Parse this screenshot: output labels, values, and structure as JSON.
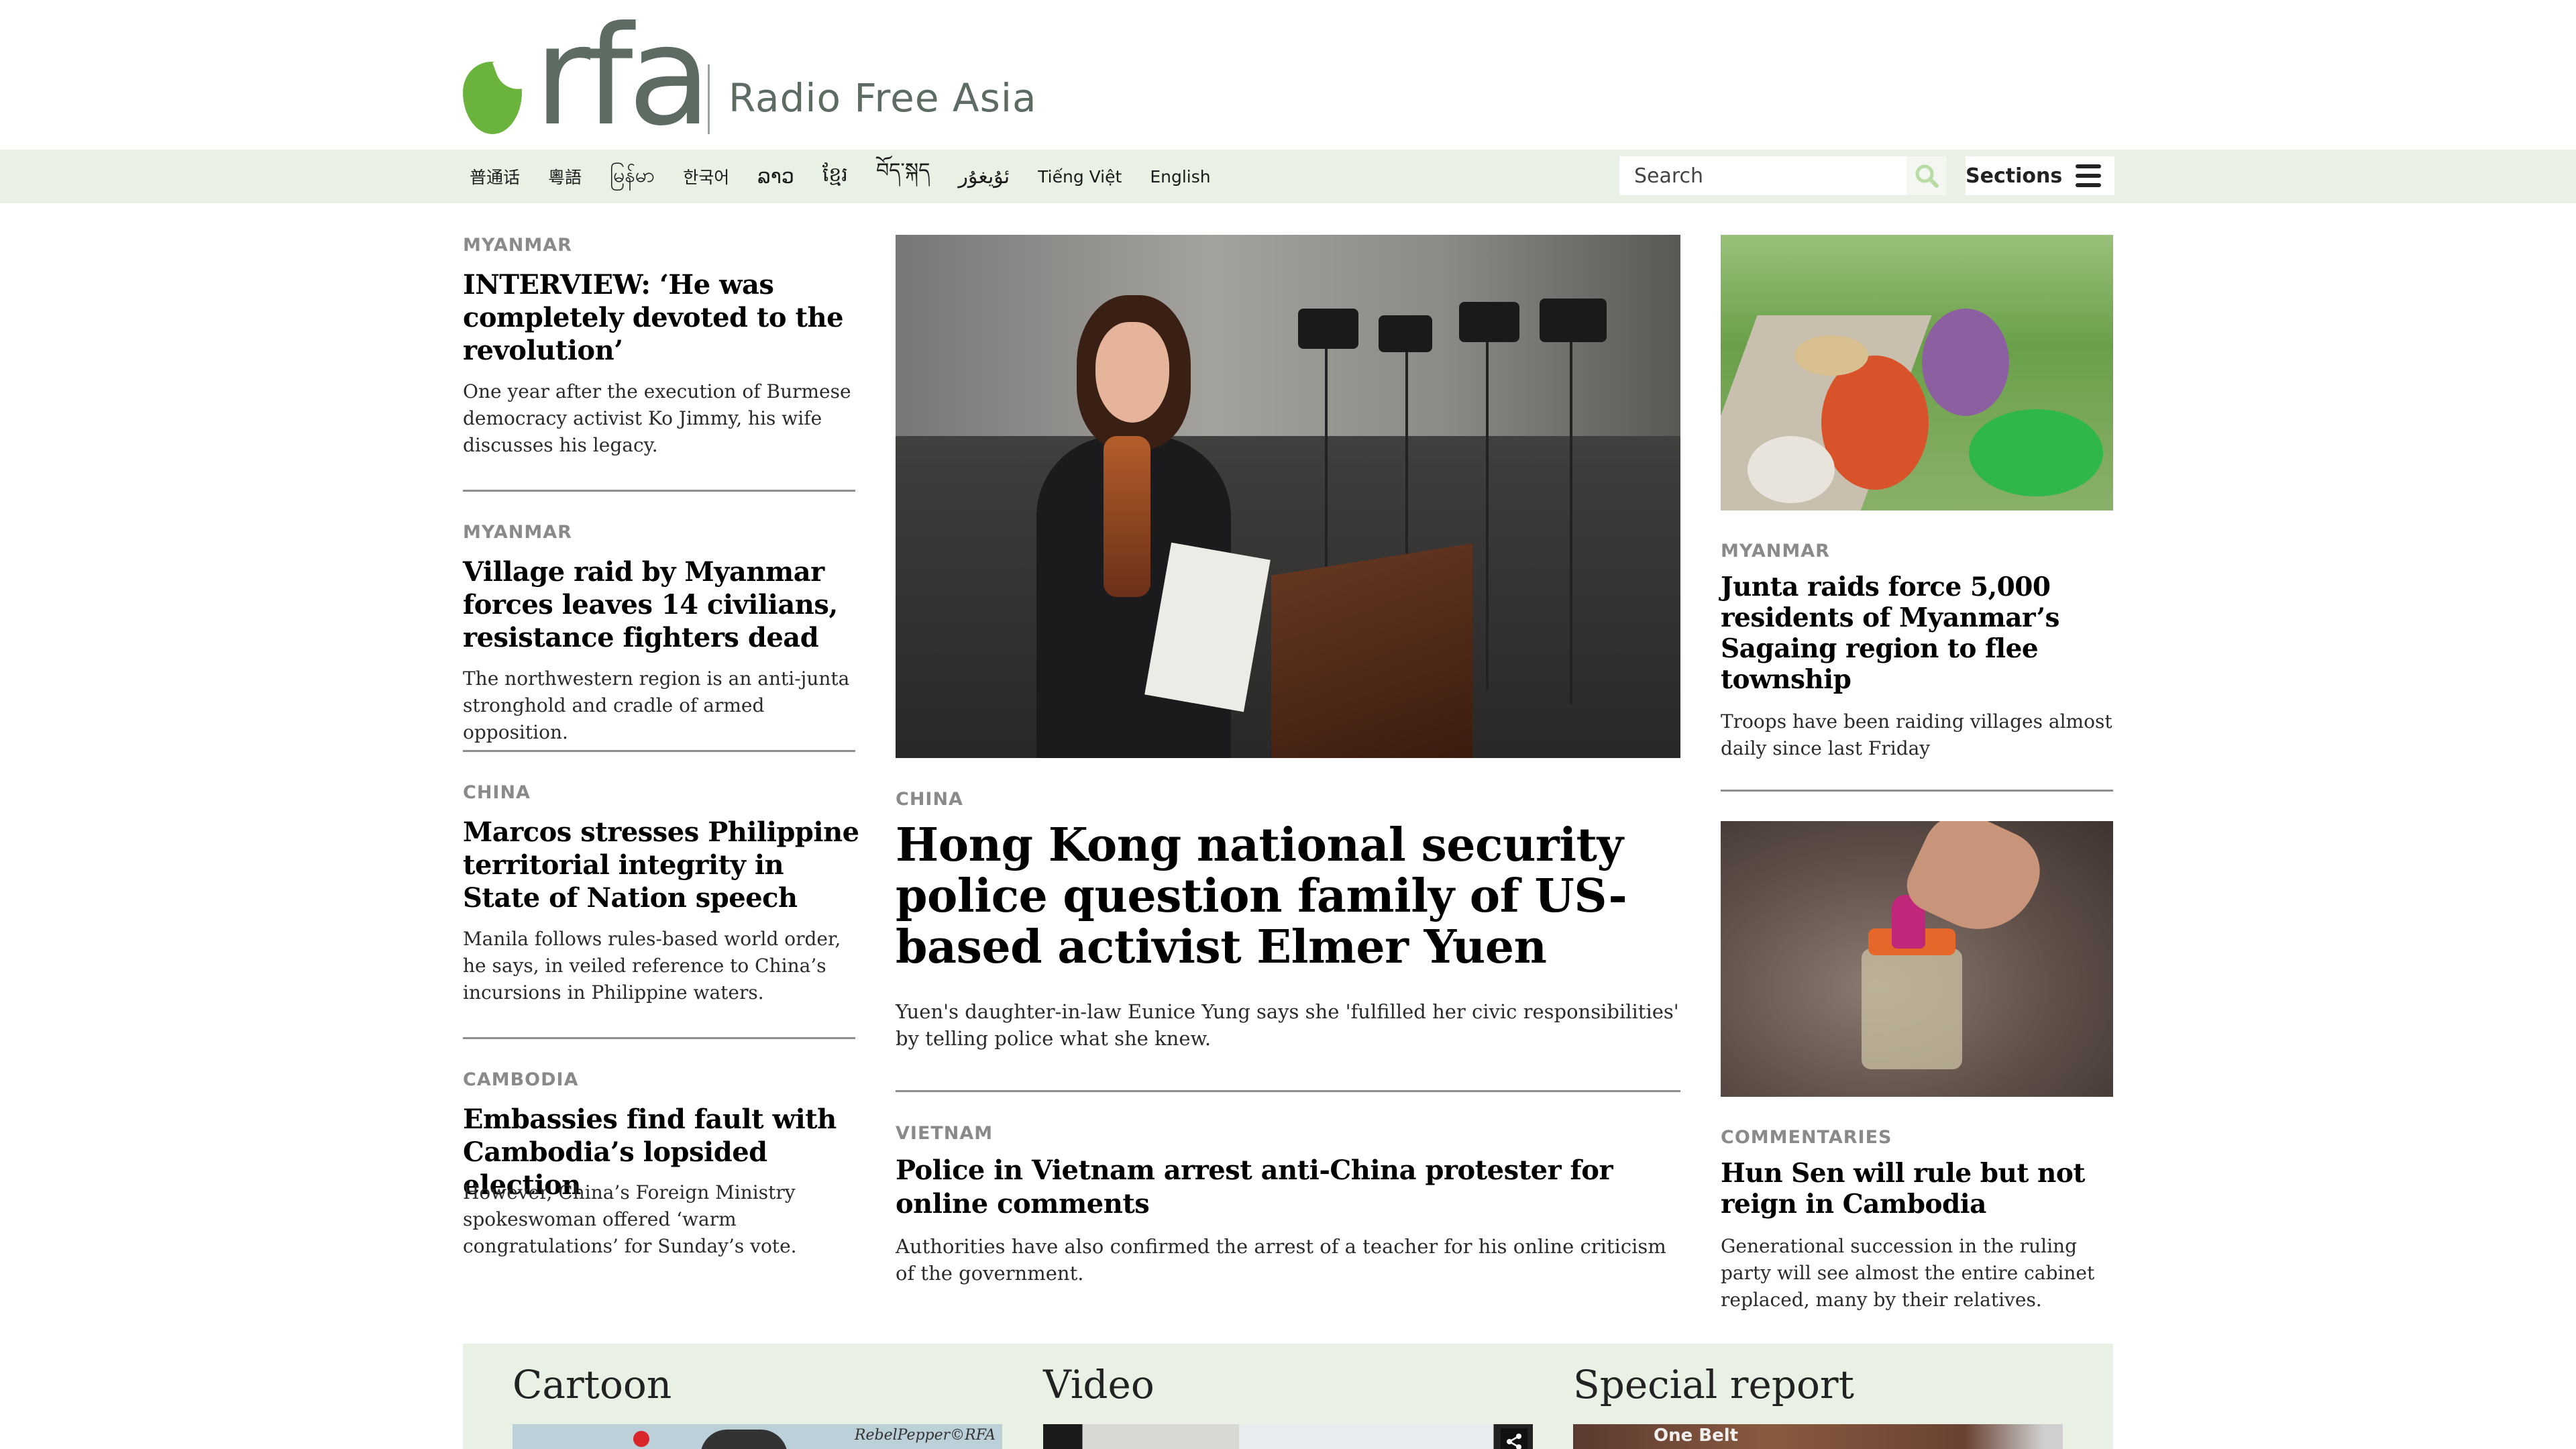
{
  "header": {
    "logo_text": "rfa",
    "tagline": "Radio Free Asia"
  },
  "nav": {
    "languages": [
      "普通话",
      "粵語",
      "မြန်မာ",
      "한국어",
      "ລາວ",
      "ខ្មែរ",
      "བོད་སྐད",
      "ئۇيغۇر",
      "Tiếng Việt",
      "English"
    ],
    "search_placeholder": "Search",
    "sections_label": "Sections"
  },
  "left_column": [
    {
      "kicker": "MYANMAR",
      "headline": "INTERVIEW: ‘He was completely devoted to the revolution’",
      "dek": "One year after the execution of Burmese democracy activist Ko Jimmy, his wife discusses his legacy."
    },
    {
      "kicker": "MYANMAR",
      "headline": "Village raid by Myanmar forces leaves 14 civilians, resistance fighters dead",
      "dek": "The northwestern region is an anti-junta stronghold and cradle of armed opposition."
    },
    {
      "kicker": "CHINA",
      "headline": "Marcos stresses Philippine territorial integrity in State of Nation speech",
      "dek": "Manila follows rules-based world order, he says, in veiled reference to China’s incursions in Philippine waters."
    },
    {
      "kicker": "CAMBODIA",
      "headline": "Embassies find fault with Cambodia’s lopsided election",
      "dek": "However, China’s Foreign Ministry spokeswoman offered ‘warm congratulations’ for Sunday’s vote."
    }
  ],
  "main_story": {
    "kicker": "CHINA",
    "headline": "Hong Kong national security police question family of US-based activist Elmer Yuen",
    "dek": "Yuen's daughter-in-law Eunice Yung says she 'fulfilled her civic responsibilities' by telling police what she knew."
  },
  "secondary_story": {
    "kicker": "VIETNAM",
    "headline": "Police in Vietnam arrest anti-China protester for online comments",
    "dek": "Authorities have also confirmed the arrest of a teacher for his online criticism of the government."
  },
  "right_column": [
    {
      "kicker": "MYANMAR",
      "headline": "Junta raids force 5,000 residents of Myanmar’s Sagaing region to flee township",
      "dek": "Troops have been raiding villages almost daily since last Friday"
    },
    {
      "kicker": "COMMENTARIES",
      "headline": "Hun Sen will rule but not reign in Cambodia",
      "dek": "Generational succession in the ruling party will see almost the entire cabinet replaced, many by their relatives."
    }
  ],
  "bottom": {
    "cartoon_title": "Cartoon",
    "cartoon_credit": "RebelPepper©RFA",
    "video_title": "Video",
    "special_title": "Special report",
    "special_thumb_text": "One Belt"
  },
  "icons": {
    "search": "search-icon",
    "menu": "hamburger-menu-icon",
    "share": "share-icon"
  },
  "colors": {
    "brand_green": "#6ab43e",
    "logo_gray": "#5d6b63",
    "nav_background": "#e9f1e4",
    "kicker_gray": "#8a8a8a"
  }
}
